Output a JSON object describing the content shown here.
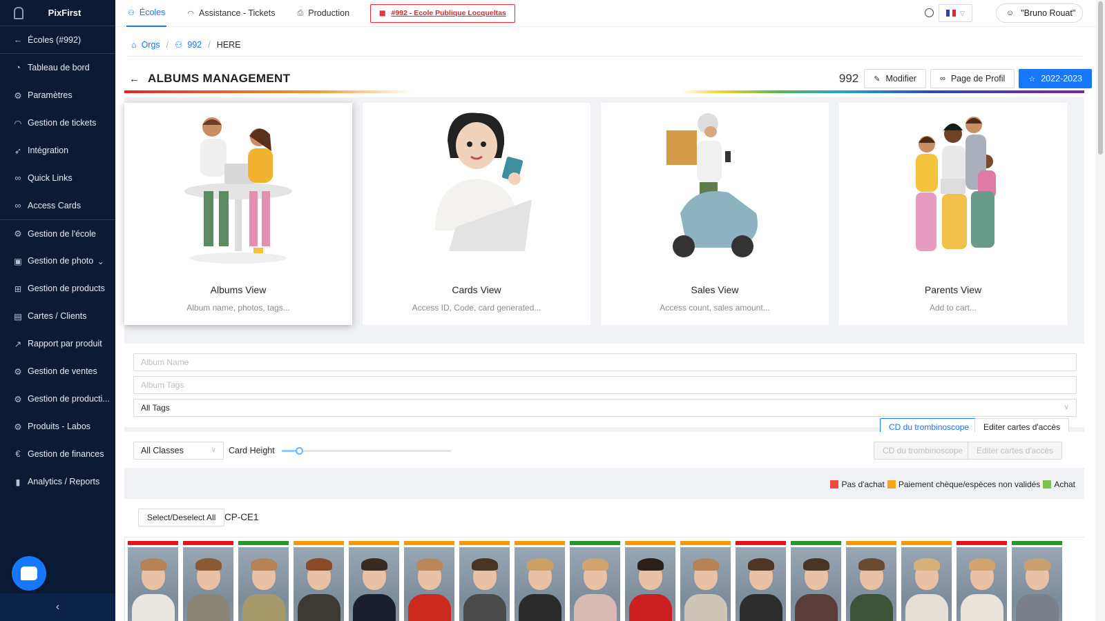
{
  "sidebar": {
    "brand": "PixFirst",
    "back_label": "Écoles (#992)",
    "items": [
      {
        "label": "Tableau de bord",
        "icon": "dashboard-icon"
      },
      {
        "label": "Paramètres",
        "icon": "gear-icon"
      },
      {
        "label": "Gestion de tickets",
        "icon": "headset-icon"
      },
      {
        "label": "Intégration",
        "icon": "rocket-icon"
      },
      {
        "label": "Quick Links",
        "icon": "link-icon"
      },
      {
        "label": "Access Cards",
        "icon": "link-icon"
      },
      {
        "label": "Gestion de l'école",
        "icon": "gear-icon"
      },
      {
        "label": "Gestion de photo",
        "icon": "image-icon"
      },
      {
        "label": "Gestion de products",
        "icon": "gift-icon"
      },
      {
        "label": "Cartes / Clients",
        "icon": "id-card-icon"
      },
      {
        "label": "Rapport par produit",
        "icon": "line-chart-icon"
      },
      {
        "label": "Gestion de ventes",
        "icon": "gear-icon"
      },
      {
        "label": "Gestion de producti...",
        "icon": "gear-icon"
      },
      {
        "label": "Produits - Labos",
        "icon": "gear-icon"
      },
      {
        "label": "Gestion de finances",
        "icon": "euro-icon"
      },
      {
        "label": "Analytics / Reports",
        "icon": "bar-chart-icon"
      }
    ]
  },
  "header": {
    "tabs": [
      {
        "label": "Écoles",
        "icon": "team-icon"
      },
      {
        "label": "Assistance - Tickets",
        "icon": "headset-icon"
      },
      {
        "label": "Production",
        "icon": "printer-icon"
      }
    ],
    "school_tag": "#992 - Ecole Publique Locqueltas",
    "user": "\"Bruno Rouat\""
  },
  "breadcrumb": {
    "home": "Orgs",
    "school": "992",
    "current": "HERE"
  },
  "page": {
    "title": "ALBUMS MANAGEMENT",
    "school_number": "992",
    "modify_label": "Modifier",
    "profile_label": "Page de Profil",
    "year_label": "2022-2023"
  },
  "views": [
    {
      "title": "Albums View",
      "desc": "Album name, photos, tags..."
    },
    {
      "title": "Cards View",
      "desc": "Access ID, Code, card generated..."
    },
    {
      "title": "Sales View",
      "desc": "Access count, sales amount..."
    },
    {
      "title": "Parents View",
      "desc": "Add to cart..."
    }
  ],
  "filters": {
    "album_name_placeholder": "Album Name",
    "album_tags_placeholder": "Album Tags",
    "tags_select": "All Tags",
    "btn_cd": "CD du trombinoscope",
    "btn_edit_cards": "Editer cartes d'accès",
    "class_select": "All Classes",
    "card_height_label": "Card Height",
    "card_height_value": 0.1
  },
  "legend": [
    {
      "label": "Pas d'achat",
      "color": "#f5473f"
    },
    {
      "label": "Paiement chèque/espèces non validés",
      "color": "#faa21a"
    },
    {
      "label": "Achat",
      "color": "#7cc24d"
    }
  ],
  "students": {
    "select_all_label": "Select/Deselect All",
    "class_name": "CP-CE1",
    "status_colors": [
      "#e8101a",
      "#e8101a",
      "#1f9a27",
      "#f59a00",
      "#f59a00",
      "#f59a00",
      "#f59a00",
      "#f59a00",
      "#1f9a27",
      "#f59a00",
      "#f59a00",
      "#e8101a",
      "#1f9a27",
      "#f59a00",
      "#f59a00",
      "#e8101a",
      "#1f9a27"
    ],
    "hair_colors": [
      "#b48457",
      "#8a5a36",
      "#b48457",
      "#8a4a2a",
      "#3b2a1f",
      "#b9885a",
      "#4a3424",
      "#caa065",
      "#d0a46c",
      "#2b1f18",
      "#b48457",
      "#4e3524",
      "#4a3424",
      "#6b4a32",
      "#d6b27a",
      "#d0a46c",
      "#c9a170"
    ],
    "shirt_colors": [
      "#e9e6e1",
      "#8a8478",
      "#a49a6c",
      "#3d3a36",
      "#1b1f2c",
      "#cc2a1f",
      "#4a4a4a",
      "#2b2b2b",
      "#d9b9b6",
      "#cc1f1f",
      "#cdc5b8",
      "#2d2d2d",
      "#5a3d3a",
      "#3d5236",
      "#e5dfd8",
      "#e9e3dc",
      "#7a7f8a"
    ]
  }
}
